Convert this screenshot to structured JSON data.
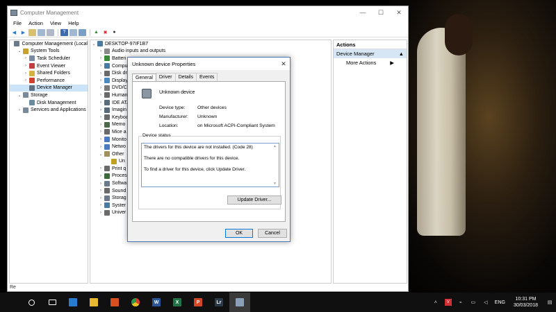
{
  "window": {
    "title": "Computer Management",
    "controls": [
      "—",
      "☐",
      "✕"
    ]
  },
  "menu": [
    "File",
    "Action",
    "View",
    "Help"
  ],
  "tree": [
    {
      "label": "Computer Management (Local",
      "indent": 0,
      "arrow": "",
      "color": "#6a7a8a"
    },
    {
      "label": "System Tools",
      "indent": 1,
      "arrow": "⌄",
      "color": "#c8a030"
    },
    {
      "label": "Task Scheduler",
      "indent": 2,
      "arrow": "›",
      "color": "#7a8aa0"
    },
    {
      "label": "Event Viewer",
      "indent": 2,
      "arrow": "›",
      "color": "#c04040"
    },
    {
      "label": "Shared Folders",
      "indent": 2,
      "arrow": "›",
      "color": "#d8b040"
    },
    {
      "label": "Performance",
      "indent": 2,
      "arrow": "›",
      "color": "#d04030"
    },
    {
      "label": "Device Manager",
      "indent": 2,
      "arrow": "",
      "color": "#607080",
      "selected": true
    },
    {
      "label": "Storage",
      "indent": 1,
      "arrow": "⌄",
      "color": "#7a8a9a"
    },
    {
      "label": "Disk Management",
      "indent": 2,
      "arrow": "",
      "color": "#6a8aa0"
    },
    {
      "label": "Services and Applications",
      "indent": 1,
      "arrow": "›",
      "color": "#7a8a9a"
    }
  ],
  "devices": {
    "root": "DESKTOP-97IF1B7",
    "items": [
      {
        "label": "Audio inputs and outputs",
        "arrow": "›",
        "color": "#8a8a8a"
      },
      {
        "label": "Batteri",
        "arrow": "›",
        "color": "#3a8a3a"
      },
      {
        "label": "Compu",
        "arrow": "›",
        "color": "#4a7aa0"
      },
      {
        "label": "Disk dr",
        "arrow": "›",
        "color": "#6a6a6a"
      },
      {
        "label": "Display",
        "arrow": "›",
        "color": "#4a8ac0"
      },
      {
        "label": "DVD/C",
        "arrow": "›",
        "color": "#7a7a7a"
      },
      {
        "label": "Human",
        "arrow": "›",
        "color": "#6a6a6a"
      },
      {
        "label": "IDE ATA",
        "arrow": "›",
        "color": "#5a6a7a"
      },
      {
        "label": "Imagin",
        "arrow": "›",
        "color": "#5a6a7a"
      },
      {
        "label": "Keyboa",
        "arrow": "›",
        "color": "#6a6a6a"
      },
      {
        "label": "Memo",
        "arrow": "›",
        "color": "#4a6a4a"
      },
      {
        "label": "Mice a",
        "arrow": "›",
        "color": "#6a6a6a"
      },
      {
        "label": "Monito",
        "arrow": "›",
        "color": "#4a7ac0"
      },
      {
        "label": "Netwo",
        "arrow": "›",
        "color": "#4a7ac0"
      },
      {
        "label": "Other",
        "arrow": "⌄",
        "color": "#a09060"
      },
      {
        "label": "Un",
        "arrow": "",
        "color": "#c0a020",
        "sub": true
      },
      {
        "label": "Print q",
        "arrow": "›",
        "color": "#6a6a6a"
      },
      {
        "label": "Proces",
        "arrow": "›",
        "color": "#3a6a3a"
      },
      {
        "label": "Softwa",
        "arrow": "›",
        "color": "#6a7a8a"
      },
      {
        "label": "Sound",
        "arrow": "›",
        "color": "#6a6a6a"
      },
      {
        "label": "Storag",
        "arrow": "›",
        "color": "#6a7a8a"
      },
      {
        "label": "Syster",
        "arrow": "›",
        "color": "#4a7aa0"
      },
      {
        "label": "Univer",
        "arrow": "›",
        "color": "#6a6a6a"
      }
    ]
  },
  "actions": {
    "header": "Actions",
    "section": "Device Manager",
    "item": "More Actions"
  },
  "statusbar": "Re",
  "dialog": {
    "title": "Unknown device Properties",
    "tabs": [
      "General",
      "Driver",
      "Details",
      "Events"
    ],
    "device_name": "Unknown device",
    "props": [
      {
        "label": "Device type:",
        "value": "Other devices"
      },
      {
        "label": "Manufacturer:",
        "value": "Unknown"
      },
      {
        "label": "Location:",
        "value": "on Microsoft ACPI-Compliant System"
      }
    ],
    "status_legend": "Device status",
    "status_lines": [
      "The drivers for this device are not installed. (Code 28)",
      "",
      "There are no compatible drivers for this device.",
      "",
      "To find a driver for this device, click Update Driver."
    ],
    "update_button": "Update Driver...",
    "ok": "OK",
    "cancel": "Cancel"
  },
  "taskbar": {
    "icons": [
      {
        "name": "start-icon",
        "color": "#ffffff",
        "glyph": ""
      },
      {
        "name": "search-icon",
        "color": "#ffffff",
        "glyph": ""
      },
      {
        "name": "task-view-icon",
        "color": "#ffffff",
        "glyph": ""
      },
      {
        "name": "store-icon",
        "color": "#2a7ad0",
        "glyph": ""
      },
      {
        "name": "file-explorer-icon",
        "color": "#e8b830",
        "glyph": ""
      },
      {
        "name": "media-player-icon",
        "color": "#d85020",
        "glyph": ""
      },
      {
        "name": "chrome-icon",
        "color": "#d84030",
        "glyph": ""
      },
      {
        "name": "word-icon",
        "color": "#2b579a",
        "glyph": "W"
      },
      {
        "name": "excel-icon",
        "color": "#217346",
        "glyph": "X"
      },
      {
        "name": "powerpoint-icon",
        "color": "#d24726",
        "glyph": "P"
      },
      {
        "name": "lightroom-icon",
        "color": "#2a3a4a",
        "glyph": "Lr"
      },
      {
        "name": "computer-management-icon",
        "color": "#8aa0b8",
        "glyph": ""
      }
    ],
    "language": "ENG",
    "time": "10:31 PM",
    "date": "30/03/2018"
  }
}
